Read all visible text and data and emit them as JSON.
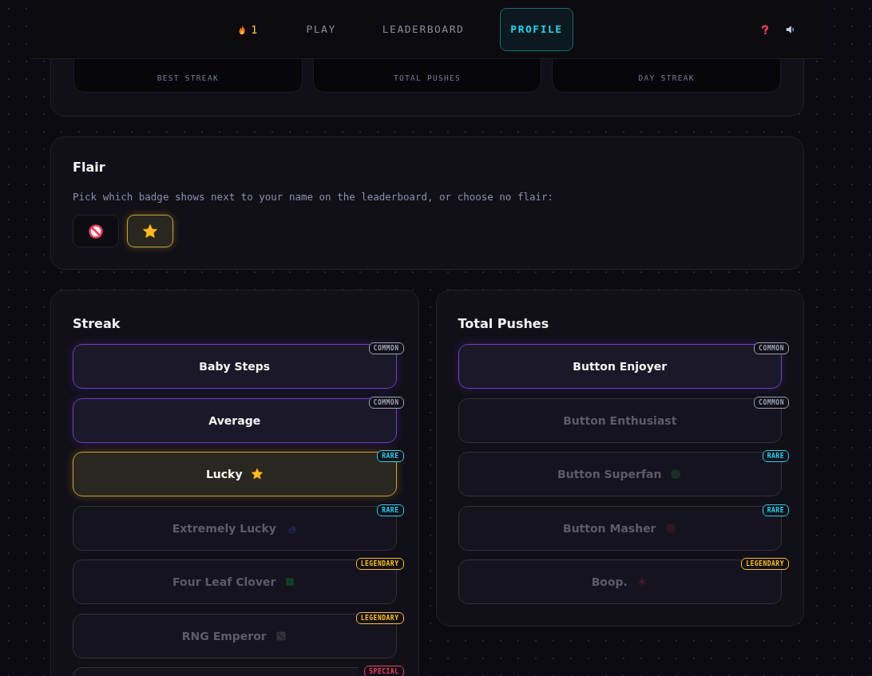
{
  "nav": {
    "streak": "1",
    "tabs": [
      {
        "label": "PLAY",
        "selected": false
      },
      {
        "label": "LEADERBOARD",
        "selected": false
      },
      {
        "label": "PROFILE",
        "selected": true
      }
    ]
  },
  "stats": [
    {
      "label": "BEST STREAK"
    },
    {
      "label": "TOTAL PUSHES"
    },
    {
      "label": "DAY STREAK"
    }
  ],
  "flair": {
    "title": "Flair",
    "description": "Pick which badge shows next to your name on the leaderboard, or choose no flair:",
    "options": [
      {
        "kind": "none",
        "selected": false
      },
      {
        "kind": "star",
        "selected": true
      }
    ]
  },
  "groups": [
    {
      "title": "Streak",
      "badges": [
        {
          "name": "Baby Steps",
          "earned": true,
          "equipped": false,
          "tag": {
            "label": "COMMON",
            "color": "#9ca3af"
          }
        },
        {
          "name": "Average",
          "earned": true,
          "equipped": false,
          "tag": {
            "label": "COMMON",
            "color": "#9ca3af"
          }
        },
        {
          "name": "Lucky",
          "earned": true,
          "equipped": true,
          "tag": {
            "label": "RARE",
            "color": "#22d3ee"
          }
        },
        {
          "name": "Extremely Lucky",
          "earned": false,
          "equipped": false,
          "tag": {
            "label": "RARE",
            "color": "#22d3ee"
          }
        },
        {
          "name": "Four Leaf Clover",
          "earned": false,
          "equipped": false,
          "tag": {
            "label": "LEGENDARY",
            "color": "#fbbf24"
          }
        },
        {
          "name": "RNG Emperor",
          "earned": false,
          "equipped": false,
          "tag": {
            "label": "LEGENDARY",
            "color": "#fbbf24"
          }
        },
        {
          "tag": {
            "label": "SPECIAL",
            "color": "#f43f5e"
          }
        }
      ]
    },
    {
      "title": "Total Pushes",
      "badges": [
        {
          "name": "Button Enjoyer",
          "earned": true,
          "equipped": false,
          "tag": {
            "label": "COMMON",
            "color": "#9ca3af"
          }
        },
        {
          "name": "Button Enthusiast",
          "earned": false,
          "equipped": false,
          "tag": {
            "label": "COMMON",
            "color": "#9ca3af"
          }
        },
        {
          "name": "Button Superfan",
          "earned": false,
          "equipped": false,
          "tag": {
            "label": "RARE",
            "color": "#22d3ee"
          }
        },
        {
          "name": "Button Masher",
          "earned": false,
          "equipped": false,
          "tag": {
            "label": "RARE",
            "color": "#22d3ee"
          }
        },
        {
          "name": "Boop.",
          "earned": false,
          "equipped": false,
          "tag": {
            "label": "LEGENDARY",
            "color": "#fbbf24"
          }
        }
      ]
    }
  ]
}
